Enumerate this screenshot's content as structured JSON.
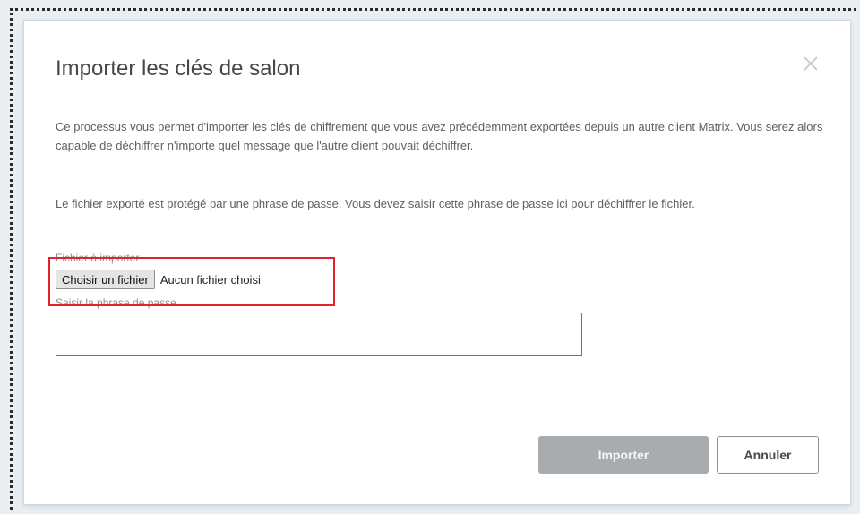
{
  "dialog": {
    "title": "Importer les clés de salon",
    "close_icon": "close-icon",
    "description_1": "Ce processus vous permet d'importer les clés de chiffrement que vous avez précédemment exportées depuis un autre client Matrix. Vous serez alors capable de déchiffrer n'importe quel message que l'autre client pouvait déchiffrer.",
    "description_2": "Le fichier exporté est protégé par une phrase de passe. Vous devez saisir cette phrase de passe ici pour déchiffrer le fichier.",
    "file_label": "Fichier à importer",
    "file_button_label": "Choisir un fichier",
    "file_status": "Aucun fichier choisi",
    "passphrase_label": "Saisir la phrase de passe",
    "passphrase_value": "",
    "import_label": "Importer",
    "cancel_label": "Annuler"
  },
  "colors": {
    "highlight": "#e0242b",
    "import_disabled": "#a9acaf"
  }
}
